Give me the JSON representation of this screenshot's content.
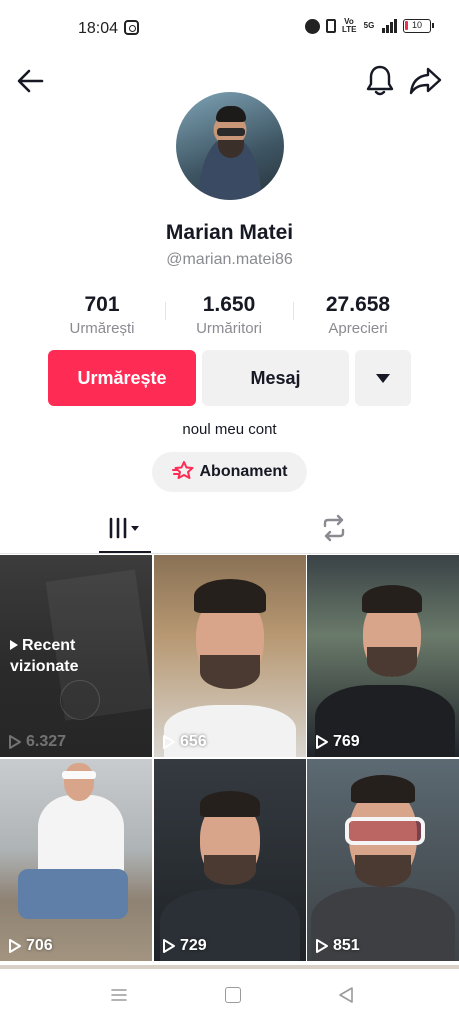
{
  "status_bar": {
    "time": "18:04",
    "battery": "10",
    "volte": "Vo LTE",
    "network": "5G"
  },
  "profile": {
    "display_name": "Marian Matei",
    "username": "@marian.matei86",
    "bio": "noul meu cont"
  },
  "stats": [
    {
      "value": "701",
      "label": "Urmărești"
    },
    {
      "value": "1.650",
      "label": "Urmăritori"
    },
    {
      "value": "27.658",
      "label": "Aprecieri"
    }
  ],
  "actions": {
    "follow_label": "Urmărește",
    "message_label": "Mesaj",
    "subscription_label": "Abonament"
  },
  "tabs": {
    "videos_icon": "grid-icon",
    "reposts_icon": "repost-icon"
  },
  "videos": [
    {
      "label": "Recent vizionate",
      "label_line1": "Recent",
      "label_line2": "vizionate",
      "views": "6.327"
    },
    {
      "views": "656"
    },
    {
      "views": "769"
    },
    {
      "views": "706"
    },
    {
      "views": "729"
    },
    {
      "views": "851"
    }
  ],
  "colors": {
    "accent": "#fe2c55",
    "button_gray": "#f1f1f2",
    "text_secondary": "#8a8b91"
  },
  "icons": [
    "back-arrow-icon",
    "bell-icon",
    "share-icon",
    "caret-down-icon",
    "subscription-star-icon",
    "play-icon",
    "menu-icon",
    "home-icon",
    "back-icon"
  ]
}
